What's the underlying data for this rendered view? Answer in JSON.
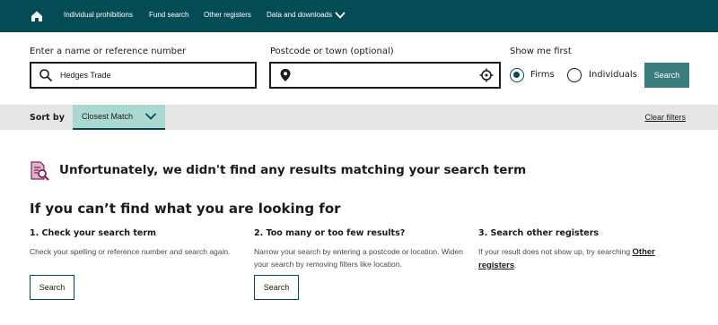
{
  "nav": {
    "home_icon": "home-icon",
    "links": [
      "Individual prohibitions",
      "Fund search",
      "Other registers",
      "Data and downloads"
    ],
    "dropdown_icon": "chevron-down-icon"
  },
  "search": {
    "name_label": "Enter a name or reference number",
    "name_value": "Hedges Trade",
    "name_icon": "search-icon",
    "postcode_label": "Postcode or town (optional)",
    "postcode_value": "",
    "postcode_icons": [
      "location-pin-icon",
      "crosshair-icon"
    ],
    "show_label": "Show me first",
    "options": [
      "Firms",
      "Individuals"
    ],
    "selected": "Firms",
    "button": "Search"
  },
  "sort": {
    "label": "Sort by",
    "selected": "Closest Match",
    "clear": "Clear filters"
  },
  "results": {
    "icon": "document-search-icon",
    "message": "Unfortunately, we didn't find any results matching your search term",
    "heading": "If you can’t find what you are looking for",
    "columns": [
      {
        "title": "1. Check your search term",
        "text": "Check your spelling or reference number and search again.",
        "button": "Search"
      },
      {
        "title": "2. Too many or too few results?",
        "text": "Narrow your search by entering a postcode or location. Widen your search by removing filters like location.",
        "button": "Search"
      },
      {
        "title": "3. Search other registers",
        "text": "If your result does not show up, try searching",
        "link": "Other registers",
        "suffix": "."
      }
    ]
  },
  "colors": {
    "nav_bg": "#034c55",
    "search_button": "#3a7b7c",
    "sort_dropdown": "#a9d9d1",
    "sort_bar": "#e5e5e5",
    "icon_accent": "#8b1e5a"
  }
}
